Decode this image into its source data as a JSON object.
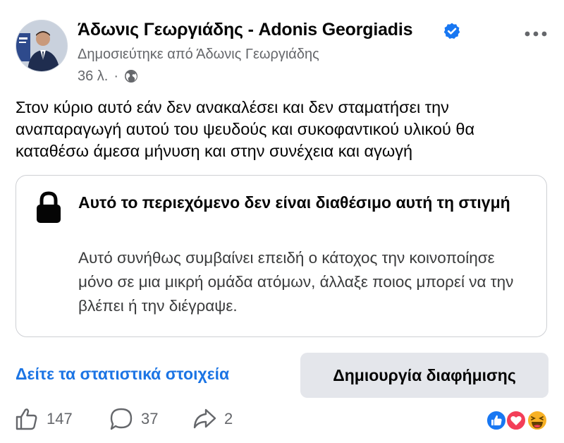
{
  "post": {
    "author": "Άδωνις Γεωργιάδης - Adonis Georgiadis",
    "posted_by": "Δημοσιεύτηκε από Άδωνις Γεωργιάδης",
    "time": "36 λ.",
    "separator": "·",
    "text": "Στον κύριο αυτό εάν δεν ανακαλέσει και δεν σταματήσει την αναπαραγωγή αυτού του ψευδούς και συκοφαντικού υλικού θα καταθέσω άμεσα μήνυση και στην συνέχεια και αγωγή"
  },
  "unavailable": {
    "title": "Αυτό το περιεχόμενο δεν είναι διαθέσιμο αυτή τη στιγμή",
    "body": "Αυτό συνήθως συμβαίνει επειδή ο κάτοχος την κοινοποίησε μόνο σε μια μικρή ομάδα ατόμων, άλλαξε ποιος μπορεί να την βλέπει ή την διέγραψε."
  },
  "actions": {
    "stats_link": "Δείτε τα στατιστικά στοιχεία",
    "boost_button": "Δημιουργία διαφήμισης",
    "likes": "147",
    "comments": "37",
    "shares": "2"
  },
  "icons": {
    "verified": "verified-badge-icon",
    "privacy": "globe-icon",
    "more": "more-options-icon",
    "lock": "lock-icon",
    "like": "like-icon",
    "comment": "comment-icon",
    "share": "share-icon",
    "reactions": [
      "like-reaction-icon",
      "love-reaction-icon",
      "haha-reaction-icon"
    ]
  },
  "colors": {
    "link_blue": "#1b74e4",
    "verified_blue": "#1877f2",
    "secondary_text": "#65676b",
    "button_bg": "#e4e6eb",
    "love_red": "#f33e58",
    "haha_yellow": "#f7b125"
  }
}
